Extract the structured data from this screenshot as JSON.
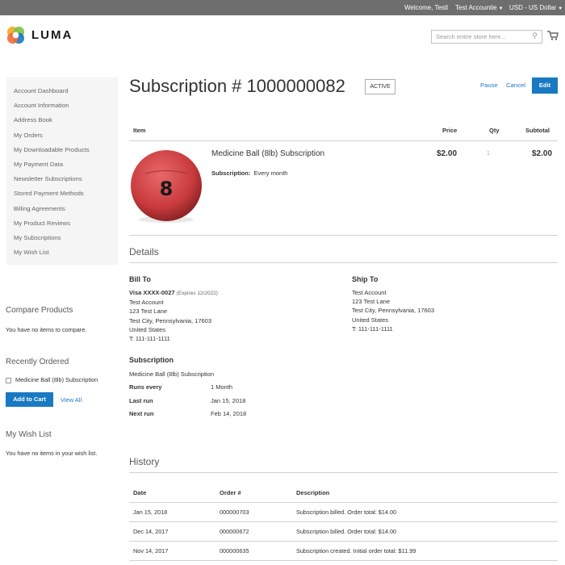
{
  "header": {
    "welcome": "Welcome, Testl",
    "account": "Test Accountie",
    "currency": "USD - US Dollar",
    "logo_text": "LUMA",
    "search_placeholder": "Search entire store here..."
  },
  "sidebar": {
    "items": [
      {
        "label": "Account Dashboard"
      },
      {
        "label": "Account Information"
      },
      {
        "label": "Address Book"
      },
      {
        "label": "My Orders"
      },
      {
        "label": "My Downloadable Products"
      },
      {
        "label": "My Payment Data"
      },
      {
        "label": "Newsletter Subscriptions"
      },
      {
        "label": "Stored Payment Methods"
      },
      {
        "label": "Billing Agreements"
      },
      {
        "label": "My Product Reviews"
      },
      {
        "label": "My Subscriptions"
      },
      {
        "label": "My Wish List"
      }
    ],
    "compare_title": "Compare Products",
    "compare_text": "You have no items to compare.",
    "recent_title": "Recently Ordered",
    "recent_item": "Medicine Ball (8lb) Subscription",
    "add_to_cart": "Add to Cart",
    "view_all": "View All",
    "wishlist_title": "My Wish List",
    "wishlist_text": "You have no items in your wish list."
  },
  "main": {
    "title": "Subscription # 1000000082",
    "status": "ACTIVE",
    "actions": {
      "pause": "Pause",
      "cancel": "Cancel",
      "edit": "Edit"
    },
    "items_table": {
      "headers": {
        "item": "Item",
        "price": "Price",
        "qty": "Qty",
        "subtotal": "Subtotal"
      },
      "product_name": "Medicine Ball (8lb) Subscription",
      "subscription_label": "Subscription:",
      "subscription_value": "Every month",
      "price": "$2.00",
      "qty": "1",
      "subtotal": "$2.00",
      "ball_number": "8"
    },
    "details": {
      "title": "Details",
      "bill_to": {
        "title": "Bill To",
        "card": "Visa XXXX-0027",
        "expires": "(Expires 12/2022)",
        "name": "Test Account",
        "street": "123 Test Lane",
        "city": "Test City, Pennsylvania, 17603",
        "country": "United States",
        "phone": "T: 111-111-1111"
      },
      "ship_to": {
        "title": "Ship To",
        "name": "Test Account",
        "street": "123 Test Lane",
        "city": "Test City, Pennsylvania, 17603",
        "country": "United States",
        "phone": "T: 111-111-1111"
      },
      "subscription": {
        "title": "Subscription",
        "product": "Medicine Ball (8lb) Subscription",
        "runs_every_label": "Runs every",
        "runs_every": "1 Month",
        "last_run_label": "Last run",
        "last_run": "Jan 15, 2018",
        "next_run_label": "Next run",
        "next_run": "Feb 14, 2018"
      }
    },
    "history": {
      "title": "History",
      "headers": {
        "date": "Date",
        "order": "Order #",
        "description": "Description"
      },
      "rows": [
        {
          "date": "Jan 15, 2018",
          "order": "000000703",
          "description": "Subscription billed. Order total: $14.00"
        },
        {
          "date": "Dec 14, 2017",
          "order": "000000672",
          "description": "Subscription billed. Order total: $14.00"
        },
        {
          "date": "Nov 14, 2017",
          "order": "000000635",
          "description": "Subscription created. Initial order total: $11.99"
        }
      ]
    }
  }
}
